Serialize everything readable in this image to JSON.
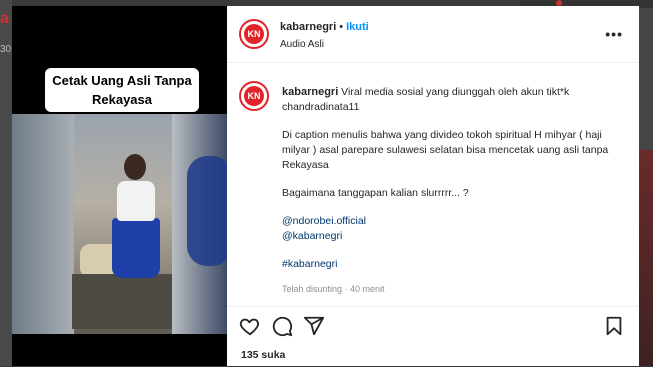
{
  "background": {
    "left_letter": "a",
    "left_text": "30"
  },
  "media": {
    "overlay_caption": "Cetak Uang Asli Tanpa Rekayasa"
  },
  "header": {
    "avatar_text": "KN",
    "username": "kabarnegri",
    "follow_label": "Ikuti",
    "audio_label": "Audio Asli",
    "more_label": "•••"
  },
  "caption": {
    "avatar_text": "KN",
    "username": "kabarnegri",
    "line1": "Viral media sosial yang diunggah oleh akun tikt*k chandradinata11",
    "line2": "Di caption menulis bahwa yang divideo tokoh spiritual H mihyar ( haji milyar ) asal parepare sulawesi selatan bisa mencetak uang asli tanpa Rekayasa",
    "line3": "Bagaimana tanggapan kalian slurrrrr... ?",
    "mention1": "@ndorobei.official",
    "mention2": "@kabarnegri",
    "hashtag": "#kabarnegri",
    "meta": "Telah disunting · 40 menit"
  },
  "actions": {
    "likes": "135 suka"
  },
  "colors": {
    "accent": "#e3232a",
    "link": "#0095f6",
    "mention": "#00376b"
  }
}
